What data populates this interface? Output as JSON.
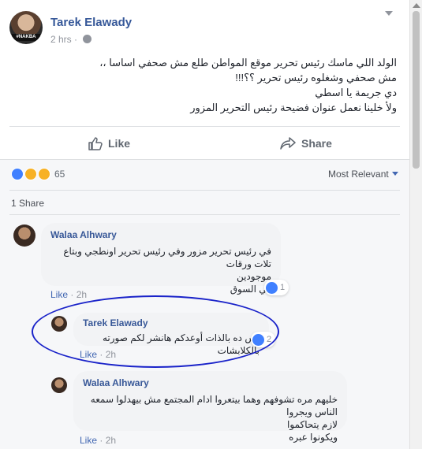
{
  "post": {
    "author": "Tarek Elawady",
    "avatar_tag": "#NAKBA",
    "time": "2 hrs · ",
    "text_lines": [
      "الولد اللي ماسك رئيس تحرير موقع المواطن طلع مش صحفي اساسا ،،",
      "مش صحفي وشغلوه رئيس تحرير ؟؟!!!",
      "دي جريمة يا اسطي",
      "ولأ خلينا نعمل عنوان فضيحة رئيس التحرير المزور"
    ],
    "like_label": "Like",
    "share_label": "Share"
  },
  "reactions": {
    "count": "65",
    "sort_label": "Most Relevant"
  },
  "shares": "1 Share",
  "comments": [
    {
      "author": "Walaa Alhwary",
      "text_lines": [
        "في رئيس تحرير مزور وفي رئيس تحرير اونطجي وبتاع تلات ورقات",
        "موجودين",
        "في السوق"
      ],
      "like_label": "Like",
      "time": "2h",
      "likes": "1"
    },
    {
      "author": "Tarek Elawady",
      "text_lines": [
        "بس ده بالذات أوعدكم هانشر لكم صورته بالكلابشات"
      ],
      "like_label": "Like",
      "time": "2h",
      "likes": "2"
    },
    {
      "author": "Walaa Alhwary",
      "text_lines": [
        "خليهم مره تشوفهم وهما بيتعروا ادام المجتمع مش بيهدلوا سمعه الناس ويجروا",
        "لازم يتحاكموا",
        "ويكونوا عبره"
      ],
      "like_label": "Like",
      "time": "2h"
    }
  ],
  "colors": {
    "link": "#365899",
    "like_blue": "#4080ff",
    "annotation": "#1a23c9"
  }
}
